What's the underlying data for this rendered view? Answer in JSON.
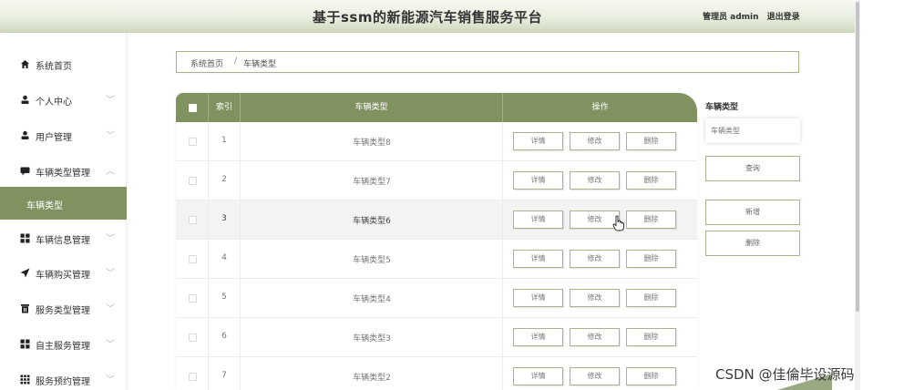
{
  "header": {
    "title": "基于ssm的新能源汽车销售服务平台",
    "user_label": "管理员 admin",
    "logout_label": "退出登录"
  },
  "sidebar": {
    "items": [
      {
        "label": "系统首页",
        "icon": "home-icon"
      },
      {
        "label": "个人中心",
        "icon": "person-icon"
      },
      {
        "label": "用户管理",
        "icon": "user-icon"
      },
      {
        "label": "车辆类型管理",
        "icon": "chat-icon"
      },
      {
        "label": "车辆类型",
        "icon": ""
      },
      {
        "label": "车辆信息管理",
        "icon": "grid-icon"
      },
      {
        "label": "车辆购买管理",
        "icon": "send-icon"
      },
      {
        "label": "服务类型管理",
        "icon": "trash-icon"
      },
      {
        "label": "自主服务管理",
        "icon": "grid-icon"
      },
      {
        "label": "服务预约管理",
        "icon": "apps-icon"
      }
    ]
  },
  "breadcrumb": {
    "home": "系统首页",
    "separator": "/",
    "current": "车辆类型"
  },
  "table": {
    "columns": [
      "索引",
      "车辆类型",
      "操作"
    ],
    "rows": [
      {
        "index": "1",
        "type": "车辆类型8"
      },
      {
        "index": "2",
        "type": "车辆类型7"
      },
      {
        "index": "3",
        "type": "车辆类型6"
      },
      {
        "index": "4",
        "type": "车辆类型5"
      },
      {
        "index": "5",
        "type": "车辆类型4"
      },
      {
        "index": "6",
        "type": "车辆类型3"
      },
      {
        "index": "7",
        "type": "车辆类型2"
      }
    ],
    "actions": {
      "detail": "详情",
      "edit": "修改",
      "delete": "删除"
    }
  },
  "search": {
    "label": "车辆类型",
    "placeholder": "车辆类型",
    "query_button": "查询",
    "add_button": "新增",
    "delete_button": "删除"
  },
  "watermark": "CSDN @佳倫毕设源码",
  "colors": {
    "accent": "#7f9260",
    "border": "#a7b58b"
  }
}
